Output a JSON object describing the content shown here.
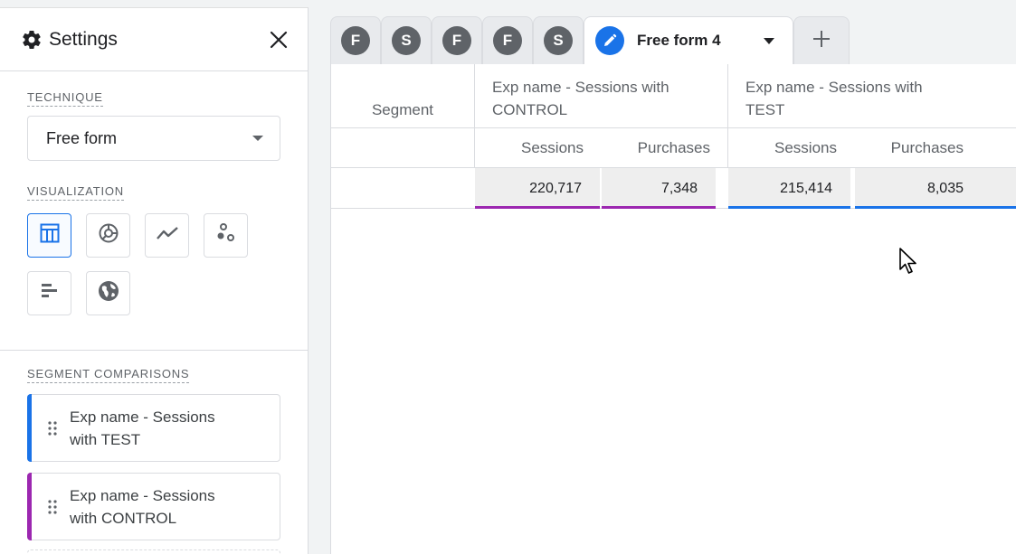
{
  "settings": {
    "title": "Settings",
    "technique_label": "TECHNIQUE",
    "technique_value": "Free form",
    "visualization_label": "VISUALIZATION",
    "viz_icons": [
      "table-icon",
      "donut-chart-icon",
      "line-chart-icon",
      "scatter-plot-icon",
      "bar-chart-icon",
      "globe-icon"
    ],
    "segment_comparisons_label": "SEGMENT COMPARISONS",
    "segments": [
      {
        "label": "Exp name - Sessions with TEST",
        "color": "#1a73e8"
      },
      {
        "label": "Exp name - Sessions with CONTROL",
        "color": "#9c27b0"
      }
    ]
  },
  "tabs": {
    "items": [
      "F",
      "S",
      "F",
      "F",
      "S"
    ],
    "active_label": "Free form 4",
    "add_label": "+"
  },
  "table": {
    "segment_header": "Segment",
    "groups": [
      {
        "title": "Exp name - Sessions with CONTROL",
        "color": "#9c27b0",
        "columns": [
          "Sessions",
          "Purchases"
        ],
        "values": [
          "220,717",
          "7,348"
        ]
      },
      {
        "title": "Exp name - Sessions with TEST",
        "color": "#1a73e8",
        "columns": [
          "Sessions",
          "Purchases"
        ],
        "values": [
          "215,414",
          "8,035"
        ]
      }
    ]
  },
  "colors": {
    "accent": "#1a73e8",
    "control": "#9c27b0",
    "test": "#1a73e8"
  }
}
